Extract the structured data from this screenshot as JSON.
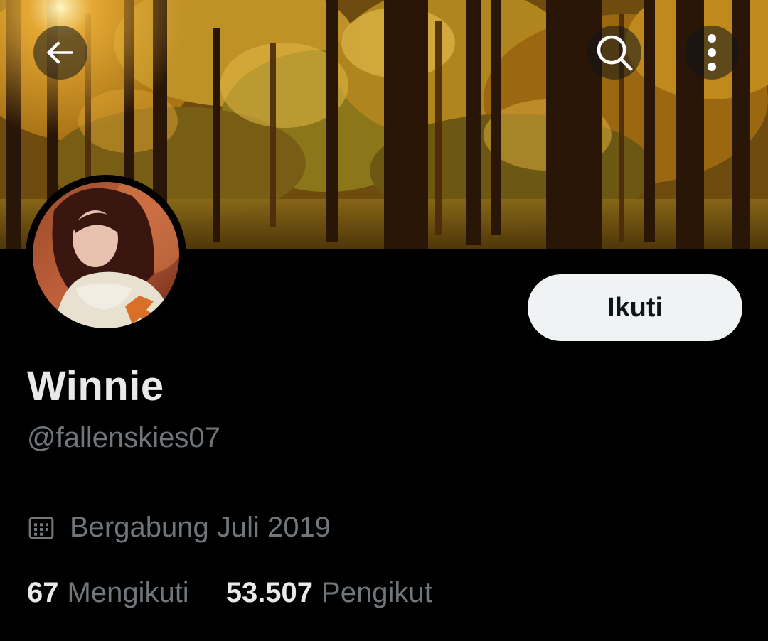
{
  "header": {
    "icons": {
      "back": "arrow-left-icon",
      "search": "search-icon",
      "more": "more-vertical-icon"
    }
  },
  "profile": {
    "display_name": "Winnie",
    "handle": "@fallenskies07",
    "joined": "Bergabung Juli 2019",
    "follow_label": "Ikuti"
  },
  "stats": {
    "following_count": "67",
    "following_label": "Mengikuti",
    "followers_count": "53.507",
    "followers_label": "Pengikut"
  },
  "colors": {
    "background": "#000000",
    "primary_text": "#e7e9ea",
    "secondary_text": "#71767b",
    "button_bg": "#eff3f4",
    "button_text": "#0f1419"
  }
}
